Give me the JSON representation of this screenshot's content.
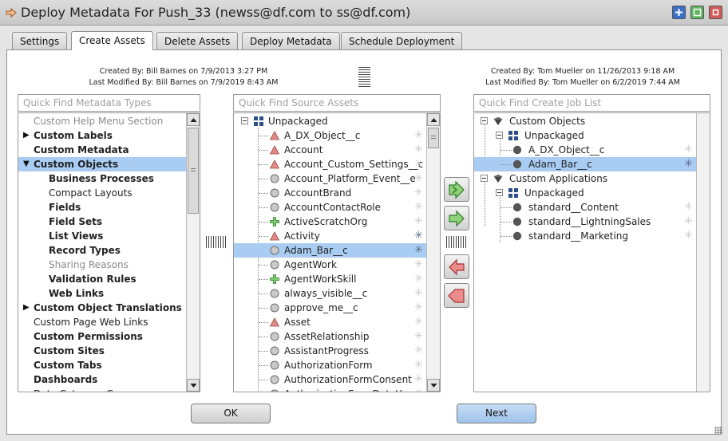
{
  "window": {
    "title": "Deploy Metadata For Push_33 (newss@df.com to ss@df.com)"
  },
  "tabs": [
    {
      "label": "Settings",
      "active": false
    },
    {
      "label": "Create Assets",
      "active": true
    },
    {
      "label": "Delete Assets",
      "active": false
    },
    {
      "label": "Deploy Metadata",
      "active": false
    },
    {
      "label": "Schedule Deployment",
      "active": false
    }
  ],
  "source_info": {
    "created": "Created By: Bill Barnes on 7/9/2013 3:27 PM",
    "modified": "Last Modified By: Bill Barnes on 7/9/2019 8:43 AM"
  },
  "target_info": {
    "created": "Created By: Tom Mueller on 11/26/2013 9:18 AM",
    "modified": "Last Modified By: Tom Mueller on 6/2/2019 7:44 AM"
  },
  "metadata_types": {
    "placeholder": "Quick Find Metadata Types",
    "items": [
      {
        "label": "Custom Help Menu Section",
        "style": "grey",
        "indent": 0,
        "expander": ""
      },
      {
        "label": "Custom Labels",
        "style": "bold",
        "indent": 0,
        "expander": "collapsed"
      },
      {
        "label": "Custom Metadata",
        "style": "bold",
        "indent": 0,
        "expander": ""
      },
      {
        "label": "Custom Objects",
        "style": "bold",
        "indent": 0,
        "expander": "expanded",
        "selected": true
      },
      {
        "label": "Business Processes",
        "style": "bold",
        "indent": 1,
        "expander": ""
      },
      {
        "label": "Compact Layouts",
        "style": "normal",
        "indent": 1,
        "expander": ""
      },
      {
        "label": "Fields",
        "style": "bold",
        "indent": 1,
        "expander": ""
      },
      {
        "label": "Field Sets",
        "style": "bold",
        "indent": 1,
        "expander": ""
      },
      {
        "label": "List Views",
        "style": "bold",
        "indent": 1,
        "expander": ""
      },
      {
        "label": "Record Types",
        "style": "bold",
        "indent": 1,
        "expander": ""
      },
      {
        "label": "Sharing Reasons",
        "style": "grey",
        "indent": 1,
        "expander": ""
      },
      {
        "label": "Validation Rules",
        "style": "bold",
        "indent": 1,
        "expander": ""
      },
      {
        "label": "Web Links",
        "style": "bold",
        "indent": 1,
        "expander": ""
      },
      {
        "label": "Custom Object Translations",
        "style": "bold",
        "indent": 0,
        "expander": "collapsed"
      },
      {
        "label": "Custom Page Web Links",
        "style": "normal",
        "indent": 0,
        "expander": ""
      },
      {
        "label": "Custom Permissions",
        "style": "bold",
        "indent": 0,
        "expander": ""
      },
      {
        "label": "Custom Sites",
        "style": "bold",
        "indent": 0,
        "expander": ""
      },
      {
        "label": "Custom Tabs",
        "style": "bold",
        "indent": 0,
        "expander": ""
      },
      {
        "label": "Dashboards",
        "style": "bold",
        "indent": 0,
        "expander": ""
      },
      {
        "label": "Data Category Gr...",
        "style": "normal",
        "indent": 0,
        "expander": ""
      }
    ]
  },
  "source_assets": {
    "placeholder": "Quick Find Source Assets",
    "root": "Unpackaged",
    "items": [
      {
        "label": "A_DX_Object__c",
        "icon": "triangle",
        "star": "light"
      },
      {
        "label": "Account",
        "icon": "triangle",
        "star": "light"
      },
      {
        "label": "Account_Custom_Settings__c",
        "icon": "triangle",
        "star": "light"
      },
      {
        "label": "Account_Platform_Event__e",
        "icon": "circle",
        "star": "light"
      },
      {
        "label": "AccountBrand",
        "icon": "circle",
        "star": "light"
      },
      {
        "label": "AccountContactRole",
        "icon": "circle",
        "star": "light"
      },
      {
        "label": "ActiveScratchOrg",
        "icon": "plus",
        "star": "light"
      },
      {
        "label": "Activity",
        "icon": "triangle",
        "star": "dark"
      },
      {
        "label": "Adam_Bar__c",
        "icon": "circle",
        "star": "dark",
        "selected": true
      },
      {
        "label": "AgentWork",
        "icon": "circle",
        "star": "light"
      },
      {
        "label": "AgentWorkSkill",
        "icon": "plus",
        "star": "light"
      },
      {
        "label": "always_visible__c",
        "icon": "circle",
        "star": "light"
      },
      {
        "label": "approve_me__c",
        "icon": "circle",
        "star": "light"
      },
      {
        "label": "Asset",
        "icon": "triangle",
        "star": "light"
      },
      {
        "label": "AssetRelationship",
        "icon": "circle",
        "star": "light"
      },
      {
        "label": "AssistantProgress",
        "icon": "circle",
        "star": "light"
      },
      {
        "label": "AuthorizationForm",
        "icon": "circle",
        "star": "light"
      },
      {
        "label": "AuthorizationFormConsent",
        "icon": "circle",
        "star": "light"
      },
      {
        "label": "AuthorizationFormDataUse",
        "icon": "circle",
        "star": "light"
      }
    ]
  },
  "job_list": {
    "placeholder": "Quick Find Create Job List",
    "tree": [
      {
        "label": "Custom Objects",
        "level": 0,
        "icon": "diamond",
        "toggle": true
      },
      {
        "label": "Unpackaged",
        "level": 1,
        "icon": "grid",
        "toggle": true
      },
      {
        "label": "A_DX_Object__c",
        "level": 2,
        "icon": "dot",
        "star": "light"
      },
      {
        "label": "Adam_Bar__c",
        "level": 2,
        "icon": "dot",
        "star": "dark",
        "selected": true
      },
      {
        "label": "Custom Applications",
        "level": 0,
        "icon": "diamond",
        "toggle": true
      },
      {
        "label": "Unpackaged",
        "level": 1,
        "icon": "grid",
        "toggle": true
      },
      {
        "label": "standard__Content",
        "level": 2,
        "icon": "dot",
        "star": "light"
      },
      {
        "label": "standard__LightningSales",
        "level": 2,
        "icon": "dot",
        "star": "light"
      },
      {
        "label": "standard__Marketing",
        "level": 2,
        "icon": "dot",
        "star": "light"
      }
    ]
  },
  "transfer_buttons": [
    {
      "icon": "add-all-icon"
    },
    {
      "icon": "add-selected-icon"
    },
    {
      "icon": "remove-selected-icon"
    },
    {
      "icon": "remove-all-icon"
    }
  ],
  "footer": {
    "ok_label": "OK",
    "next_label": "Next"
  },
  "colors": {
    "selection": "#a9ccf3",
    "triangle_icon": "#e08a86",
    "plus_icon": "#55b24a",
    "grid_icon": "#2b4f86",
    "next_button": "#a9cdf0"
  }
}
